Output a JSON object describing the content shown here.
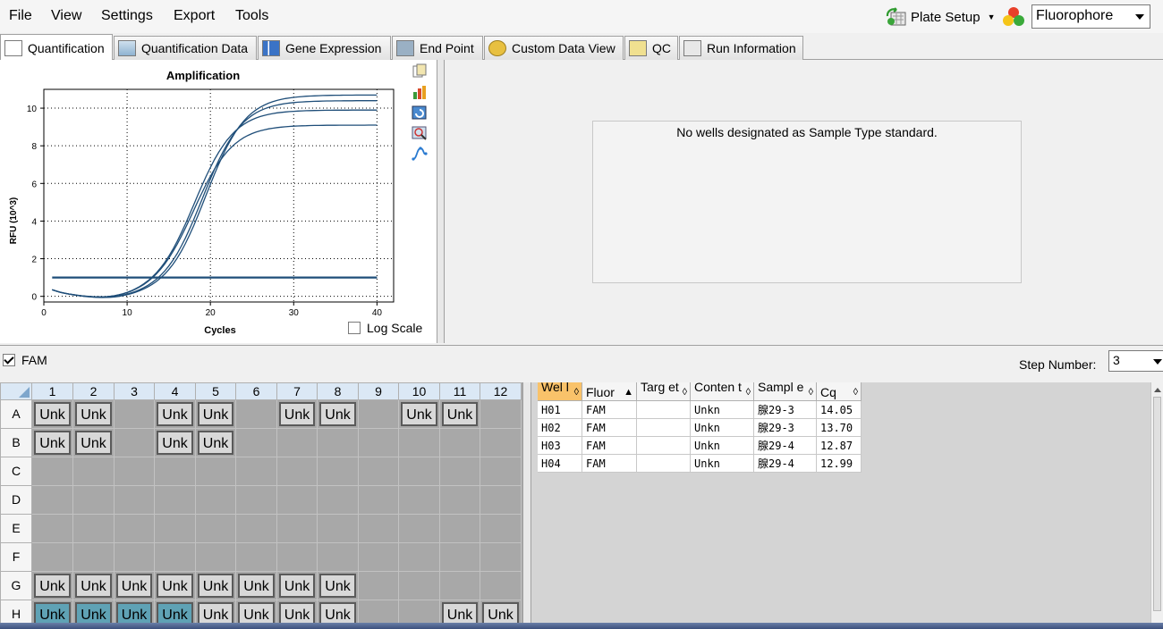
{
  "menu": {
    "file": "File",
    "view": "View",
    "settings": "Settings",
    "export": "Export",
    "tools": "Tools"
  },
  "toolbar": {
    "plate_setup": "Plate Setup",
    "fluorophore_selected": "Fluorophore"
  },
  "tabs": [
    "Quantification",
    "Quantification Data",
    "Gene Expression",
    "End Point",
    "Custom Data View",
    "QC",
    "Run Information"
  ],
  "chart_data": {
    "type": "line",
    "title": "Amplification",
    "xlabel": "Cycles",
    "ylabel": "RFU (10^3)",
    "xlim": [
      0,
      42
    ],
    "ylim": [
      -0.3,
      11
    ],
    "xticks": [
      0,
      10,
      20,
      30,
      40
    ],
    "yticks": [
      0,
      2,
      4,
      6,
      8,
      10
    ],
    "grid": true,
    "threshold": 1.0,
    "series": [
      {
        "plateau": 10.7,
        "cq": 14.05
      },
      {
        "plateau": 10.4,
        "cq": 13.7
      },
      {
        "plateau": 9.9,
        "cq": 12.87
      },
      {
        "plateau": 9.1,
        "cq": 12.99
      }
    ]
  },
  "chart_options": {
    "log_scale_label": "Log Scale",
    "log_scale_checked": false
  },
  "standard_message": "No wells designated as Sample Type standard.",
  "fluor_filter": {
    "label": "FAM",
    "checked": true
  },
  "step": {
    "label": "Step Number:",
    "value": "3"
  },
  "plate": {
    "columns": [
      "1",
      "2",
      "3",
      "4",
      "5",
      "6",
      "7",
      "8",
      "9",
      "10",
      "11",
      "12"
    ],
    "rows": [
      "A",
      "B",
      "C",
      "D",
      "E",
      "F",
      "G",
      "H"
    ],
    "wells": {
      "A": [
        "Unk",
        "Unk",
        "",
        "Unk",
        "Unk",
        "",
        "Unk",
        "Unk",
        "",
        "Unk",
        "Unk",
        ""
      ],
      "B": [
        "Unk",
        "Unk",
        "",
        "Unk",
        "Unk",
        "",
        "",
        "",
        "",
        "",
        "",
        ""
      ],
      "C": [
        "",
        "",
        "",
        "",
        "",
        "",
        "",
        "",
        "",
        "",
        "",
        ""
      ],
      "D": [
        "",
        "",
        "",
        "",
        "",
        "",
        "",
        "",
        "",
        "",
        "",
        ""
      ],
      "E": [
        "",
        "",
        "",
        "",
        "",
        "",
        "",
        "",
        "",
        "",
        "",
        ""
      ],
      "F": [
        "",
        "",
        "",
        "",
        "",
        "",
        "",
        "",
        "",
        "",
        "",
        ""
      ],
      "G": [
        "Unk",
        "Unk",
        "Unk",
        "Unk",
        "Unk",
        "Unk",
        "Unk",
        "Unk",
        "",
        "",
        "",
        ""
      ],
      "H": [
        "Unk",
        "Unk",
        "Unk",
        "Unk",
        "Unk",
        "Unk",
        "Unk",
        "Unk",
        "",
        "",
        "Unk",
        "Unk"
      ]
    },
    "selected_row": "H",
    "selected_cols": [
      0,
      1,
      2,
      3
    ]
  },
  "table": {
    "headers": [
      "Wel l",
      "Fluor",
      "Targ et",
      "Conten t",
      "Sampl e",
      "Cq"
    ],
    "rows": [
      [
        "H01",
        "FAM",
        "",
        "Unkn",
        "腺29-3",
        "14.05"
      ],
      [
        "H02",
        "FAM",
        "",
        "Unkn",
        "腺29-3",
        "13.70"
      ],
      [
        "H03",
        "FAM",
        "",
        "Unkn",
        "腺29-4",
        "12.87"
      ],
      [
        "H04",
        "FAM",
        "",
        "Unkn",
        "腺29-4",
        "12.99"
      ]
    ]
  }
}
